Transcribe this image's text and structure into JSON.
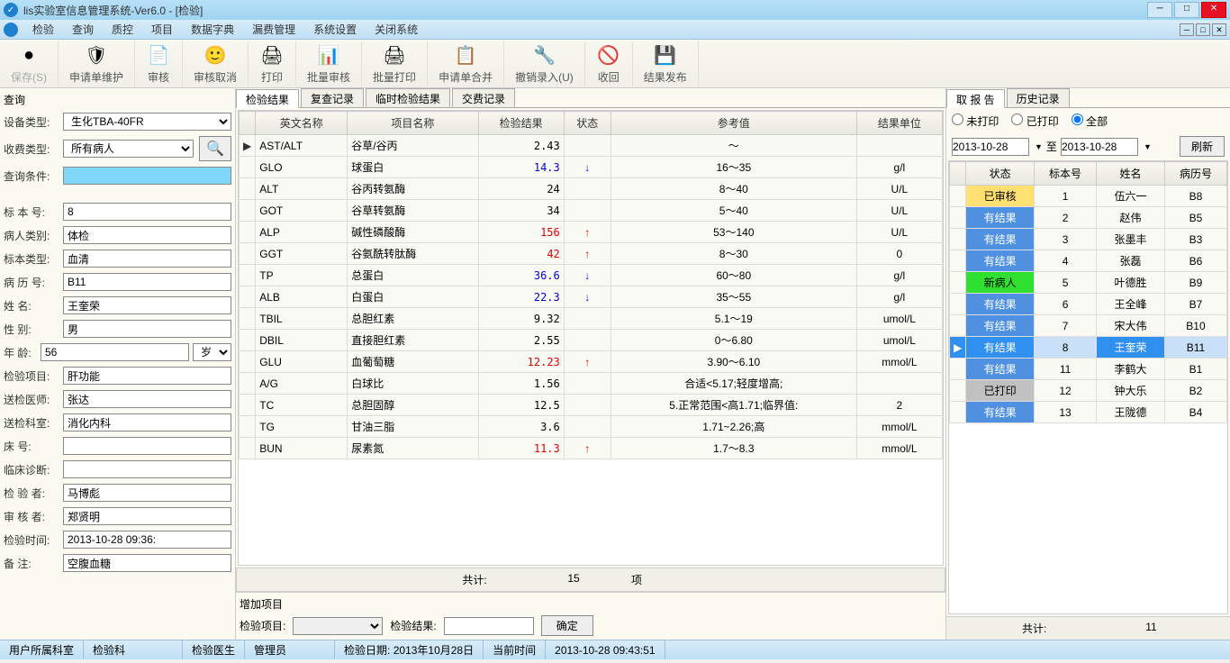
{
  "window": {
    "title": "lis实验室信息管理系统-Ver6.0   -  [检验]"
  },
  "menu": [
    "检验",
    "查询",
    "质控",
    "项目",
    "数据字典",
    "漏费管理",
    "系统设置",
    "关闭系统"
  ],
  "toolbar": [
    {
      "label": "保存(S)",
      "icon": "●",
      "disabled": true
    },
    {
      "label": "申请单维护",
      "icon": "🛡"
    },
    {
      "label": "审核",
      "icon": "📄"
    },
    {
      "label": "审核取消",
      "icon": "🙂"
    },
    {
      "label": "打印",
      "icon": "🖨"
    },
    {
      "label": "批量审核",
      "icon": "📊"
    },
    {
      "label": "批量打印",
      "icon": "🖨"
    },
    {
      "label": "申请单合并",
      "icon": "📋"
    },
    {
      "label": "撤销录入(U)",
      "icon": "🔧"
    },
    {
      "label": "收回",
      "icon": "🚫"
    },
    {
      "label": "结果发布",
      "icon": "💾"
    }
  ],
  "query": {
    "title": "查询",
    "device_label": "设备类型:",
    "device": "生化TBA-40FR",
    "fee_label": "收费类型:",
    "fee": "所有病人",
    "cond_label": "查询条件:",
    "cond": ""
  },
  "patient": {
    "fields": [
      {
        "label": "标 本 号:",
        "value": "8"
      },
      {
        "label": "病人类别:",
        "value": "体检"
      },
      {
        "label": "标本类型:",
        "value": "血清"
      },
      {
        "label": "病 历 号:",
        "value": "B11"
      },
      {
        "label": "姓    名:",
        "value": "王奎荣"
      },
      {
        "label": "性    别:",
        "value": "男"
      },
      {
        "label": "年    龄:",
        "value": "56",
        "unit": "岁"
      },
      {
        "label": "检验项目:",
        "value": "肝功能"
      },
      {
        "label": "送检医师:",
        "value": "张达"
      },
      {
        "label": "送检科室:",
        "value": "消化内科"
      },
      {
        "label": "床    号:",
        "value": ""
      },
      {
        "label": "临床诊断:",
        "value": ""
      },
      {
        "label": "检 验 者:",
        "value": "马博彪"
      },
      {
        "label": "审 核 者:",
        "value": "郑贤明"
      },
      {
        "label": "检验时间:",
        "value": "2013-10-28 09:36:"
      },
      {
        "label": "备    注:",
        "value": "空腹血糖"
      }
    ]
  },
  "center_tabs": [
    "检验结果",
    "复查记录",
    "临时检验结果",
    "交费记录"
  ],
  "grid_headers": [
    "英文名称",
    "项目名称",
    "检验结果",
    "状态",
    "参考值",
    "结果单位"
  ],
  "grid_rows": [
    {
      "mark": "▶",
      "en": "AST/ALT",
      "name": "谷草/谷丙",
      "result": "2.43",
      "cls": "",
      "arrow": "",
      "ref": "～",
      "unit": ""
    },
    {
      "en": "GLO",
      "name": "球蛋白",
      "result": "14.3",
      "cls": "blue",
      "arrow": "↓",
      "ref": "16～35",
      "unit": "g/l"
    },
    {
      "en": "ALT",
      "name": "谷丙转氨酶",
      "result": "24",
      "cls": "",
      "arrow": "",
      "ref": "8～40",
      "unit": "U/L"
    },
    {
      "en": "GOT",
      "name": "谷草转氨酶",
      "result": "34",
      "cls": "",
      "arrow": "",
      "ref": "5～40",
      "unit": "U/L"
    },
    {
      "en": "ALP",
      "name": "碱性磷酸酶",
      "result": "156",
      "cls": "red",
      "arrow": "↑",
      "ref": "53～140",
      "unit": "U/L"
    },
    {
      "en": "GGT",
      "name": "谷氨酰转肽酶",
      "result": "42",
      "cls": "red",
      "arrow": "↑",
      "ref": "8～30",
      "unit": "0"
    },
    {
      "en": "TP",
      "name": "总蛋白",
      "result": "36.6",
      "cls": "blue",
      "arrow": "↓",
      "ref": "60～80",
      "unit": "g/l"
    },
    {
      "en": "ALB",
      "name": "白蛋白",
      "result": "22.3",
      "cls": "blue",
      "arrow": "↓",
      "ref": "35～55",
      "unit": "g/l"
    },
    {
      "en": "TBIL",
      "name": "总胆红素",
      "result": "9.32",
      "cls": "",
      "arrow": "",
      "ref": "5.1～19",
      "unit": "umol/L"
    },
    {
      "en": "DBIL",
      "name": "直接胆红素",
      "result": "2.55",
      "cls": "",
      "arrow": "",
      "ref": "0～6.80",
      "unit": "umol/L"
    },
    {
      "en": "GLU",
      "name": "血葡萄糖",
      "result": "12.23",
      "cls": "red",
      "arrow": "↑",
      "ref": "3.90～6.10",
      "unit": "mmol/L"
    },
    {
      "en": "A/G",
      "name": "白球比",
      "result": "1.56",
      "cls": "",
      "arrow": "",
      "ref": "合适<5.17;轻度增高;",
      "unit": ""
    },
    {
      "en": "TC",
      "name": "总胆固醇",
      "result": "12.5",
      "cls": "",
      "arrow": "",
      "ref": "5.正常范围<高1.71;临界值:",
      "unit": "2"
    },
    {
      "en": "TG",
      "name": "甘油三脂",
      "result": "3.6",
      "cls": "",
      "arrow": "",
      "ref": "1.71~2.26;高",
      "unit": "mmol/L"
    },
    {
      "en": "BUN",
      "name": "尿素氮",
      "result": "11.3",
      "cls": "red",
      "arrow": "↑",
      "ref": "1.7～8.3",
      "unit": "mmol/L"
    }
  ],
  "grid_total": {
    "label": "共计:",
    "count": "15",
    "unit": "项"
  },
  "add": {
    "title": "增加项目",
    "proj_label": "检验项目:",
    "result_label": "检验结果:",
    "btn": "确定"
  },
  "right_tabs": [
    "取 报 告",
    "历史记录"
  ],
  "radios": {
    "unprint": "未打印",
    "printed": "已打印",
    "all": "全部"
  },
  "dates": {
    "from": "2013-10-28",
    "to_label": "至",
    "to": "2013-10-28",
    "refresh": "刷新"
  },
  "rgrid_headers": [
    "状态",
    "标本号",
    "姓名",
    "病历号"
  ],
  "rgrid_rows": [
    {
      "status": "已审核",
      "cls": "st-audit",
      "no": "1",
      "name": "伍六一",
      "rec": "B8"
    },
    {
      "status": "有结果",
      "cls": "st-result",
      "no": "2",
      "name": "赵伟",
      "rec": "B5"
    },
    {
      "status": "有结果",
      "cls": "st-result",
      "no": "3",
      "name": "张墨丰",
      "rec": "B3"
    },
    {
      "status": "有结果",
      "cls": "st-result",
      "no": "4",
      "name": "张磊",
      "rec": "B6"
    },
    {
      "status": "新病人",
      "cls": "st-new",
      "no": "5",
      "name": "叶德胜",
      "rec": "B9"
    },
    {
      "status": "有结果",
      "cls": "st-result",
      "no": "6",
      "name": "王全峰",
      "rec": "B7"
    },
    {
      "status": "有结果",
      "cls": "st-result",
      "no": "7",
      "name": "宋大伟",
      "rec": "B10"
    },
    {
      "status": "有结果",
      "cls": "st-result",
      "no": "8",
      "name": "王奎荣",
      "rec": "B11",
      "selected": true
    },
    {
      "status": "有结果",
      "cls": "st-result",
      "no": "11",
      "name": "李鹤大",
      "rec": "B1"
    },
    {
      "status": "已打印",
      "cls": "st-print",
      "no": "12",
      "name": "钟大乐",
      "rec": "B2"
    },
    {
      "status": "有结果",
      "cls": "st-result",
      "no": "13",
      "name": "王陇德",
      "rec": "B4"
    }
  ],
  "rgrid_total": {
    "label": "共计:",
    "count": "11"
  },
  "status": {
    "dept_label": "用户所属科室",
    "dept": "检验科",
    "doc_label": "检验医生",
    "doc": "管理员",
    "date_label": "检验日期:",
    "date": "2013年10月28日",
    "now_label": "当前时间",
    "now": "2013-10-28 09:43:51"
  }
}
